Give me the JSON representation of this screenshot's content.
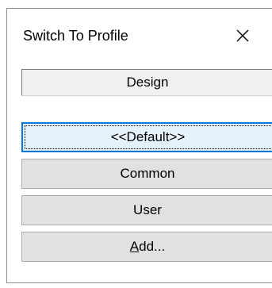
{
  "window": {
    "title": "Switch To Profile",
    "close_icon": "close-icon"
  },
  "current_profile": {
    "value": "Design"
  },
  "profiles": [
    {
      "label": "<<Default>>",
      "focused": true
    },
    {
      "label": "Common",
      "focused": false
    },
    {
      "label": "User",
      "focused": false
    }
  ],
  "add_button": {
    "mnemonic": "A",
    "rest": "dd..."
  },
  "colors": {
    "button_face": "#e1e1e1",
    "focus_border": "#0078d7",
    "field_background": "#f0f0f0"
  }
}
